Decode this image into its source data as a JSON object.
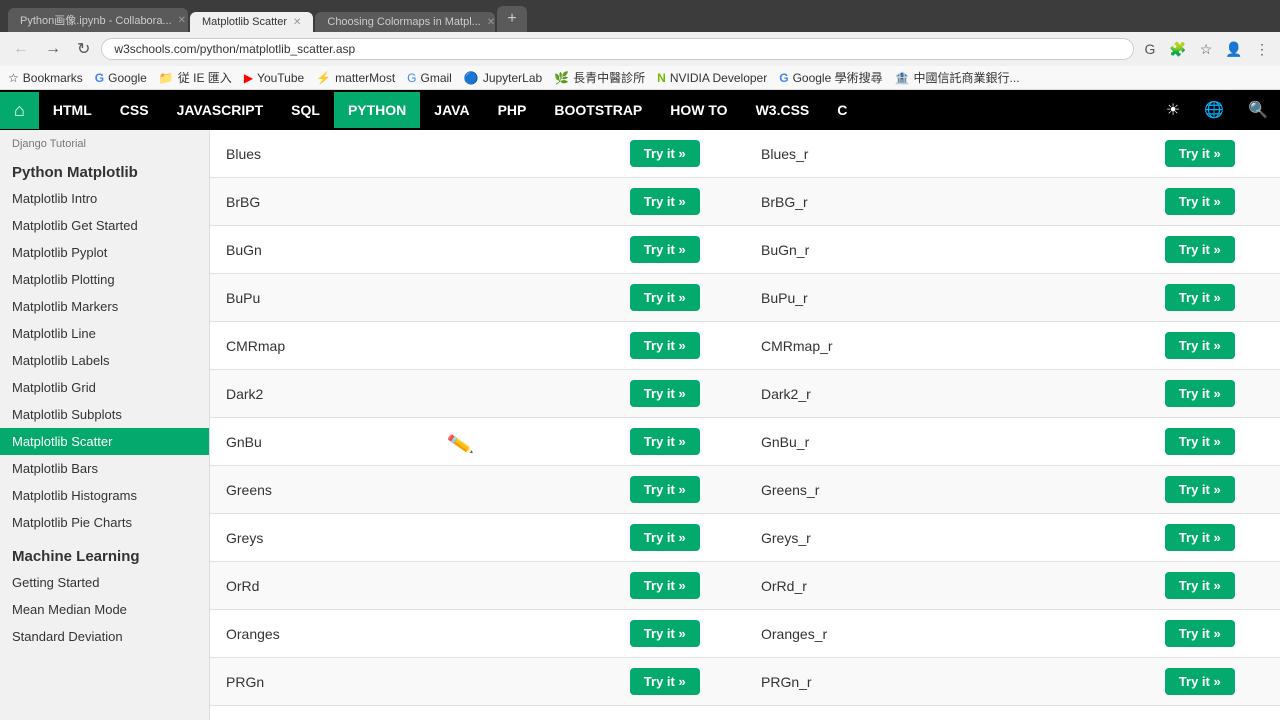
{
  "browser": {
    "tabs": [
      {
        "label": "Python画像.ipynb - Collabora...",
        "active": false
      },
      {
        "label": "Matplotlib Scatter",
        "active": true
      },
      {
        "label": "Choosing Colormaps in Matpl...",
        "active": false
      }
    ],
    "address": "w3schools.com/python/matplotlib_scatter.asp",
    "bookmarks": [
      {
        "icon": "☆",
        "label": "Bookmarks"
      },
      {
        "icon": "G",
        "label": "Google"
      },
      {
        "icon": "📁",
        "label": "従 IE 匯入"
      },
      {
        "icon": "▶",
        "label": "YouTube"
      },
      {
        "icon": "⚡",
        "label": "matterMost"
      },
      {
        "icon": "G",
        "label": "Gmail"
      },
      {
        "icon": "🔵",
        "label": "JupyterLab"
      },
      {
        "icon": "🌿",
        "label": "長青中醫診所"
      },
      {
        "icon": "N",
        "label": "NVIDIA Developer"
      },
      {
        "icon": "G",
        "label": "Google 學術搜尋"
      },
      {
        "icon": "🏦",
        "label": "中國信託商業銀行..."
      }
    ]
  },
  "w3nav": {
    "items": [
      {
        "label": "⌂",
        "id": "home",
        "class": "home"
      },
      {
        "label": "HTML",
        "id": "html"
      },
      {
        "label": "CSS",
        "id": "css"
      },
      {
        "label": "JAVASCRIPT",
        "id": "javascript"
      },
      {
        "label": "SQL",
        "id": "sql"
      },
      {
        "label": "PYTHON",
        "id": "python",
        "active": true
      },
      {
        "label": "JAVA",
        "id": "java"
      },
      {
        "label": "PHP",
        "id": "php"
      },
      {
        "label": "BOOTSTRAP",
        "id": "bootstrap"
      },
      {
        "label": "HOW TO",
        "id": "howto"
      },
      {
        "label": "W3.CSS",
        "id": "w3css"
      },
      {
        "label": "C",
        "id": "c"
      }
    ]
  },
  "sidebar": {
    "matplotlib_section": "Python Matplotlib",
    "matplotlib_items": [
      {
        "label": "Matplotlib Intro",
        "id": "intro"
      },
      {
        "label": "Matplotlib Get Started",
        "id": "getstarted"
      },
      {
        "label": "Matplotlib Pyplot",
        "id": "pyplot"
      },
      {
        "label": "Matplotlib Plotting",
        "id": "plotting"
      },
      {
        "label": "Matplotlib Markers",
        "id": "markers"
      },
      {
        "label": "Matplotlib Line",
        "id": "line"
      },
      {
        "label": "Matplotlib Labels",
        "id": "labels"
      },
      {
        "label": "Matplotlib Grid",
        "id": "grid"
      },
      {
        "label": "Matplotlib Subplots",
        "id": "subplots"
      },
      {
        "label": "Matplotlib Scatter",
        "id": "scatter",
        "active": true
      },
      {
        "label": "Matplotlib Bars",
        "id": "bars"
      },
      {
        "label": "Matplotlib Histograms",
        "id": "histograms"
      },
      {
        "label": "Matplotlib Pie Charts",
        "id": "piecharts"
      }
    ],
    "ml_section": "Machine Learning",
    "ml_items": [
      {
        "label": "Getting Started",
        "id": "ml-getstarted"
      },
      {
        "label": "Mean Median Mode",
        "id": "ml-mean"
      },
      {
        "label": "Standard Deviation",
        "id": "ml-stddev"
      }
    ]
  },
  "table": {
    "rows": [
      {
        "left": "Blues",
        "right": "Blues_r",
        "try_left": "Try it »",
        "try_right": "Try it »"
      },
      {
        "left": "BrBG",
        "right": "BrBG_r",
        "try_left": "Try it »",
        "try_right": "Try it »"
      },
      {
        "left": "BuGn",
        "right": "BuGn_r",
        "try_left": "Try it »",
        "try_right": "Try it »"
      },
      {
        "left": "BuPu",
        "right": "BuPu_r",
        "try_left": "Try it »",
        "try_right": "Try it »"
      },
      {
        "left": "CMRmap",
        "right": "CMRmap_r",
        "try_left": "Try it »",
        "try_right": "Try it »"
      },
      {
        "left": "Dark2",
        "right": "Dark2_r",
        "try_left": "Try it »",
        "try_right": "Try it »"
      },
      {
        "left": "GnBu",
        "right": "GnBu_r",
        "try_left": "Try it »",
        "try_right": "Try it »"
      },
      {
        "left": "Greens",
        "right": "Greens_r",
        "try_left": "Try it »",
        "try_right": "Try it »"
      },
      {
        "left": "Greys",
        "right": "Greys_r",
        "try_left": "Try it »",
        "try_right": "Try it »"
      },
      {
        "left": "OrRd",
        "right": "OrRd_r",
        "try_left": "Try it »",
        "try_right": "Try it »"
      },
      {
        "left": "Oranges",
        "right": "Oranges_r",
        "try_left": "Try it »",
        "try_right": "Try it »"
      },
      {
        "left": "PRGn",
        "right": "PRGn_r",
        "try_left": "Try it »",
        "try_right": "Try it »"
      }
    ]
  }
}
